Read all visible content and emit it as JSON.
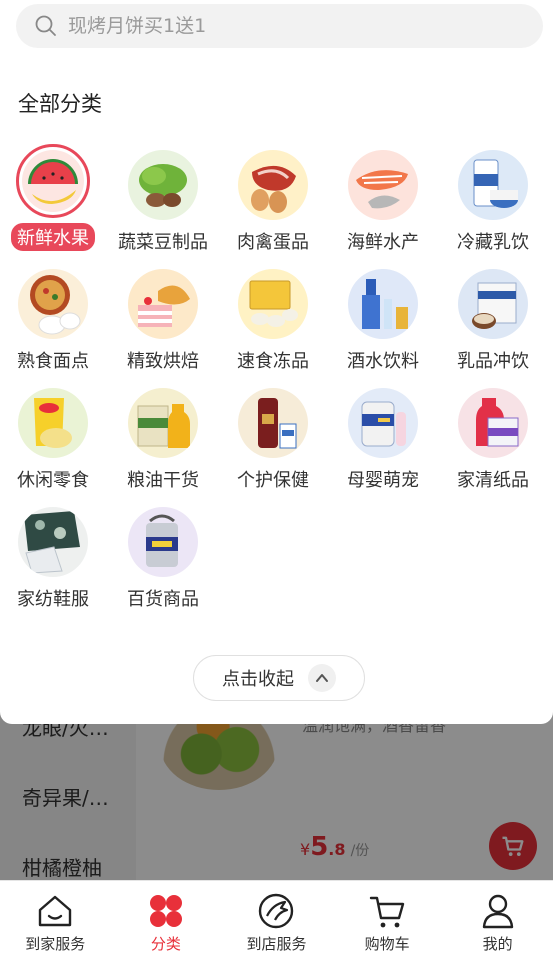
{
  "search": {
    "placeholder": "现烤月饼买1送1"
  },
  "panel": {
    "title": "全部分类",
    "categories": [
      {
        "label": "新鲜水果",
        "icon": "fruit-image",
        "active": true
      },
      {
        "label": "蔬菜豆制品",
        "icon": "vegetable-image"
      },
      {
        "label": "肉禽蛋品",
        "icon": "meat-egg-image"
      },
      {
        "label": "海鲜水产",
        "icon": "seafood-image"
      },
      {
        "label": "冷藏乳饮",
        "icon": "chilled-dairy-image"
      },
      {
        "label": "熟食面点",
        "icon": "deli-image"
      },
      {
        "label": "精致烘焙",
        "icon": "bakery-image"
      },
      {
        "label": "速食冻品",
        "icon": "frozen-food-image"
      },
      {
        "label": "酒水饮料",
        "icon": "drinks-image"
      },
      {
        "label": "乳品冲饮",
        "icon": "milk-powder-image"
      },
      {
        "label": "休闲零食",
        "icon": "snacks-image"
      },
      {
        "label": "粮油干货",
        "icon": "grain-oil-image"
      },
      {
        "label": "个护保健",
        "icon": "personal-care-image"
      },
      {
        "label": "母婴萌宠",
        "icon": "baby-pet-image"
      },
      {
        "label": "家清纸品",
        "icon": "household-cleaning-image"
      },
      {
        "label": "家纺鞋服",
        "icon": "home-textile-image"
      },
      {
        "label": "百货商品",
        "icon": "general-merchandise-image"
      }
    ],
    "collapse_label": "点击收起"
  },
  "background": {
    "sidebar_items": [
      "龙眼/火…",
      "奇异果/…",
      "柑橘橙柚"
    ],
    "product_desc": "温润饱满，酒香留香",
    "price_currency": "¥",
    "price_int": "5",
    "price_dec": ".8",
    "price_unit": "/份"
  },
  "tabbar": {
    "items": [
      {
        "label": "到家服务",
        "icon": "home-icon"
      },
      {
        "label": "分类",
        "icon": "category-icon",
        "active": true
      },
      {
        "label": "到店服务",
        "icon": "store-service-icon"
      },
      {
        "label": "购物车",
        "icon": "cart-icon"
      },
      {
        "label": "我的",
        "icon": "user-icon"
      }
    ]
  },
  "colors": {
    "accent": "#e8303a",
    "active_badge": "#e8485a"
  }
}
